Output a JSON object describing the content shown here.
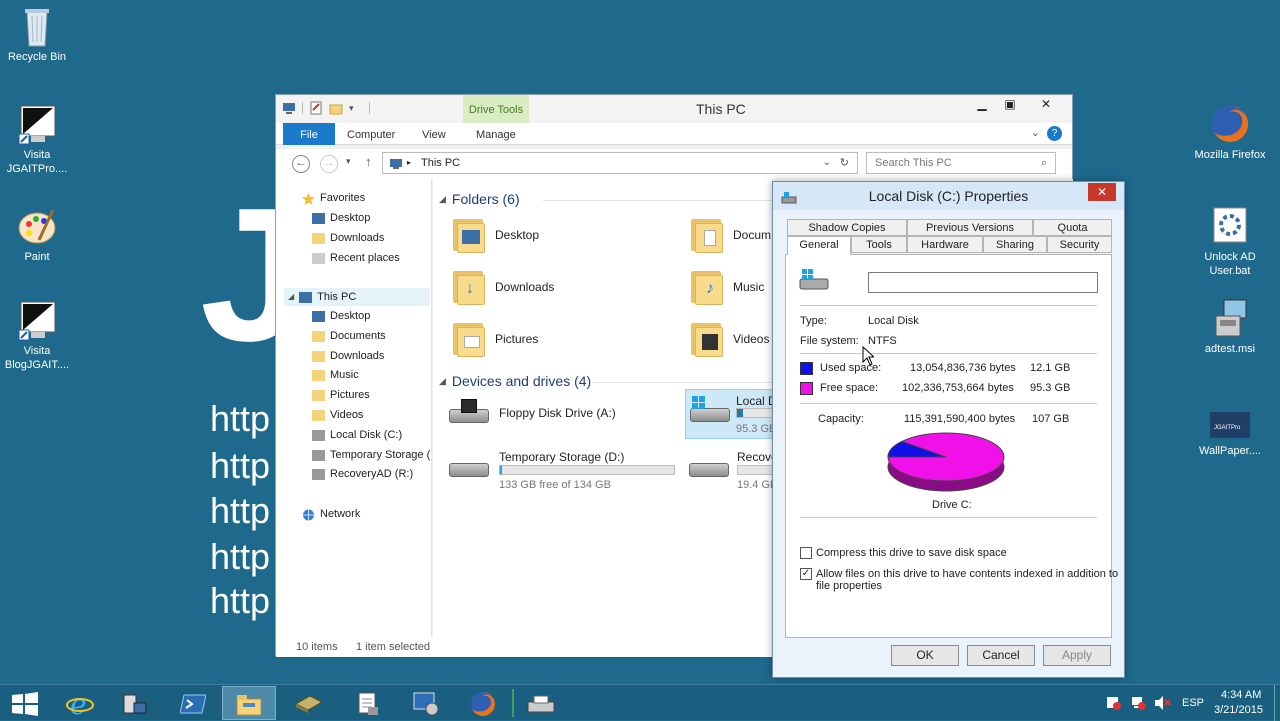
{
  "desktop": {
    "background_text": {
      "letter": "J",
      "lines": [
        "http",
        "http",
        "http",
        "http",
        "http"
      ]
    },
    "icons_left": [
      {
        "label": "Recycle Bin",
        "icon": "recycle-bin-icon"
      },
      {
        "label": "Visita JGAITPro....",
        "icon": "shortcut-icon"
      },
      {
        "label": "Paint",
        "icon": "paint-icon"
      },
      {
        "label": "Visita BlogJGAIT....",
        "icon": "shortcut-icon"
      }
    ],
    "icons_right": [
      {
        "label": "Mozilla Firefox",
        "icon": "firefox-icon"
      },
      {
        "label": "Unlock AD User.bat",
        "icon": "batch-file-icon"
      },
      {
        "label": "adtest.msi",
        "icon": "installer-icon"
      },
      {
        "label": "WallPaper....",
        "icon": "wallpaper-icon",
        "badge": "JGAITPro"
      }
    ]
  },
  "explorer": {
    "title": "This PC",
    "context_tab": "Drive Tools",
    "ribbon_tabs": [
      "File",
      "Computer",
      "View",
      "Manage"
    ],
    "address": "This PC",
    "search_placeholder": "Search This PC",
    "nav": {
      "favorites": "Favorites",
      "favorites_items": [
        "Desktop",
        "Downloads",
        "Recent places"
      ],
      "this_pc": "This PC",
      "this_pc_items": [
        "Desktop",
        "Documents",
        "Downloads",
        "Music",
        "Pictures",
        "Videos",
        "Local Disk (C:)",
        "Temporary Storage (",
        "RecoveryAD (R:)"
      ],
      "network": "Network"
    },
    "folders_header": "Folders (6)",
    "folders": [
      "Desktop",
      "Documents",
      "Downloads",
      "Music",
      "Pictures",
      "Videos"
    ],
    "folders_visible": [
      "Desktop",
      "Docum",
      "Downloads",
      "Music",
      "Pictures",
      "Videos"
    ],
    "devices_header": "Devices and drives (4)",
    "drives": {
      "floppy": {
        "label": "Floppy Disk Drive (A:)"
      },
      "local": {
        "label": "Local D",
        "free": "95.3 GB",
        "used_fraction": 0.11
      },
      "temp": {
        "label": "Temporary Storage (D:)",
        "free": "133 GB free of 134 GB",
        "used_fraction": 0.01
      },
      "recovery": {
        "label": "Recove",
        "free": "19.4 GB"
      }
    },
    "status": {
      "items": "10 items",
      "selected": "1 item selected"
    }
  },
  "properties": {
    "title": "Local Disk (C:) Properties",
    "tabs_top": [
      "Shadow Copies",
      "Previous Versions",
      "Quota"
    ],
    "tabs_bottom": [
      "General",
      "Tools",
      "Hardware",
      "Sharing",
      "Security"
    ],
    "active_tab": "General",
    "name_value": "",
    "type_label": "Type:",
    "type_value": "Local Disk",
    "fs_label": "File system:",
    "fs_value": "NTFS",
    "used_label": "Used space:",
    "used_bytes": "13,054,836,736 bytes",
    "used_gb": "12.1 GB",
    "free_label": "Free space:",
    "free_bytes": "102,336,753,664 bytes",
    "free_gb": "95.3 GB",
    "capacity_label": "Capacity:",
    "capacity_bytes": "115,391,590,400 bytes",
    "capacity_gb": "107 GB",
    "drive_label": "Drive C:",
    "compress_label": "Compress this drive to save disk space",
    "compress_checked": false,
    "index_label_1": "Allow files on this drive to have contents indexed in addition to",
    "index_label_2": "file properties",
    "index_checked": true,
    "buttons": {
      "ok": "OK",
      "cancel": "Cancel",
      "apply": "Apply"
    },
    "colors": {
      "used": "#1010e8",
      "free": "#f010e8"
    },
    "used_fraction": 0.1131
  },
  "taskbar": {
    "apps": [
      "start-icon",
      "internet-explorer-icon",
      "server-manager-icon",
      "powershell-icon",
      "file-explorer-icon",
      "disk-tool-icon",
      "notepad-icon",
      "remote-desktop-icon",
      "firefox-icon",
      "printer-icon"
    ],
    "language": "ESP",
    "time": "4:34 AM",
    "date": "3/21/2015"
  }
}
